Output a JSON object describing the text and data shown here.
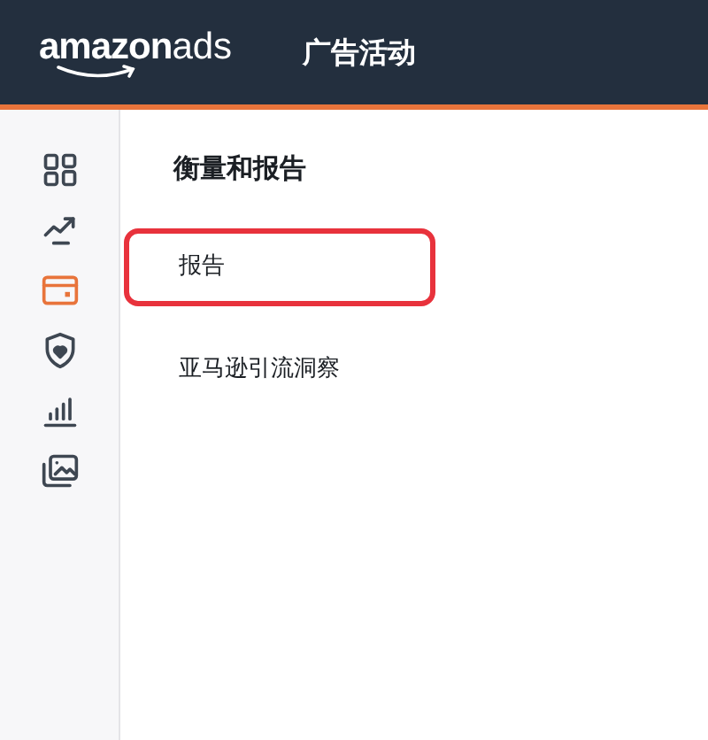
{
  "header": {
    "logo": {
      "brand": "amazon",
      "suffix": "ads"
    },
    "title": "广告活动"
  },
  "sidebar": {
    "items": [
      {
        "selected": false
      },
      {
        "selected": false
      },
      {
        "selected": true
      },
      {
        "selected": false
      },
      {
        "selected": false
      },
      {
        "selected": false
      }
    ]
  },
  "panel": {
    "heading": "衡量和报告",
    "items": [
      {
        "label": "报告",
        "highlighted": true
      },
      {
        "label": "亚马逊引流洞察",
        "highlighted": false
      }
    ]
  }
}
